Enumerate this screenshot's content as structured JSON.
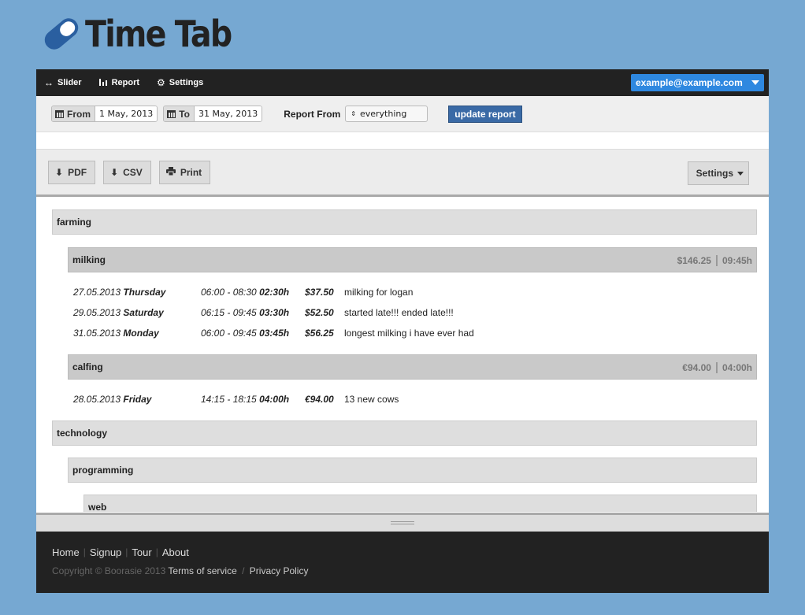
{
  "brand": {
    "name": "Time Tab",
    "color": "#2a5fa0"
  },
  "nav": {
    "items": [
      {
        "label": "Slider",
        "icon": "arrows-horizontal-icon"
      },
      {
        "label": "Report",
        "icon": "bar-chart-icon"
      },
      {
        "label": "Settings",
        "icon": "gear-icon"
      }
    ],
    "user_email": "example@example.com"
  },
  "filters": {
    "from_label": "From",
    "from_value": "1 May, 2013",
    "to_label": "To",
    "to_value": "31 May, 2013",
    "report_from_label": "Report From",
    "report_from_value": "everything",
    "update_label": "update report"
  },
  "toolbar": {
    "pdf_label": "PDF",
    "csv_label": "CSV",
    "print_label": "Print",
    "settings_label": "Settings"
  },
  "report": {
    "farming": {
      "label": "farming",
      "milking": {
        "label": "milking",
        "total_amount": "$146.25",
        "total_time": "09:45h",
        "entries": [
          {
            "date": "27.05.2013",
            "day": "Thursday",
            "range": "06:00 - 08:30",
            "duration": "02:30h",
            "amount": "$37.50",
            "desc": "milking for logan"
          },
          {
            "date": "29.05.2013",
            "day": "Saturday",
            "range": "06:15 - 09:45",
            "duration": "03:30h",
            "amount": "$52.50",
            "desc": "started late!!! ended late!!!"
          },
          {
            "date": "31.05.2013",
            "day": "Monday",
            "range": "06:00 - 09:45",
            "duration": "03:45h",
            "amount": "$56.25",
            "desc": "longest milking i have ever had"
          }
        ]
      },
      "calfing": {
        "label": "calfing",
        "total_amount": "€94.00",
        "total_time": "04:00h",
        "entries": [
          {
            "date": "28.05.2013",
            "day": "Friday",
            "range": "14:15 - 18:15",
            "duration": "04:00h",
            "amount": "€94.00",
            "desc": "13 new cows"
          }
        ]
      }
    },
    "technology": {
      "label": "technology",
      "programming": {
        "label": "programming",
        "web": {
          "label": "web"
        }
      }
    }
  },
  "footer": {
    "links": [
      "Home",
      "Signup",
      "Tour",
      "About"
    ],
    "copyright": "Copyright © Boorasie 2013",
    "terms": "Terms of service",
    "privacy": "Privacy Policy"
  }
}
